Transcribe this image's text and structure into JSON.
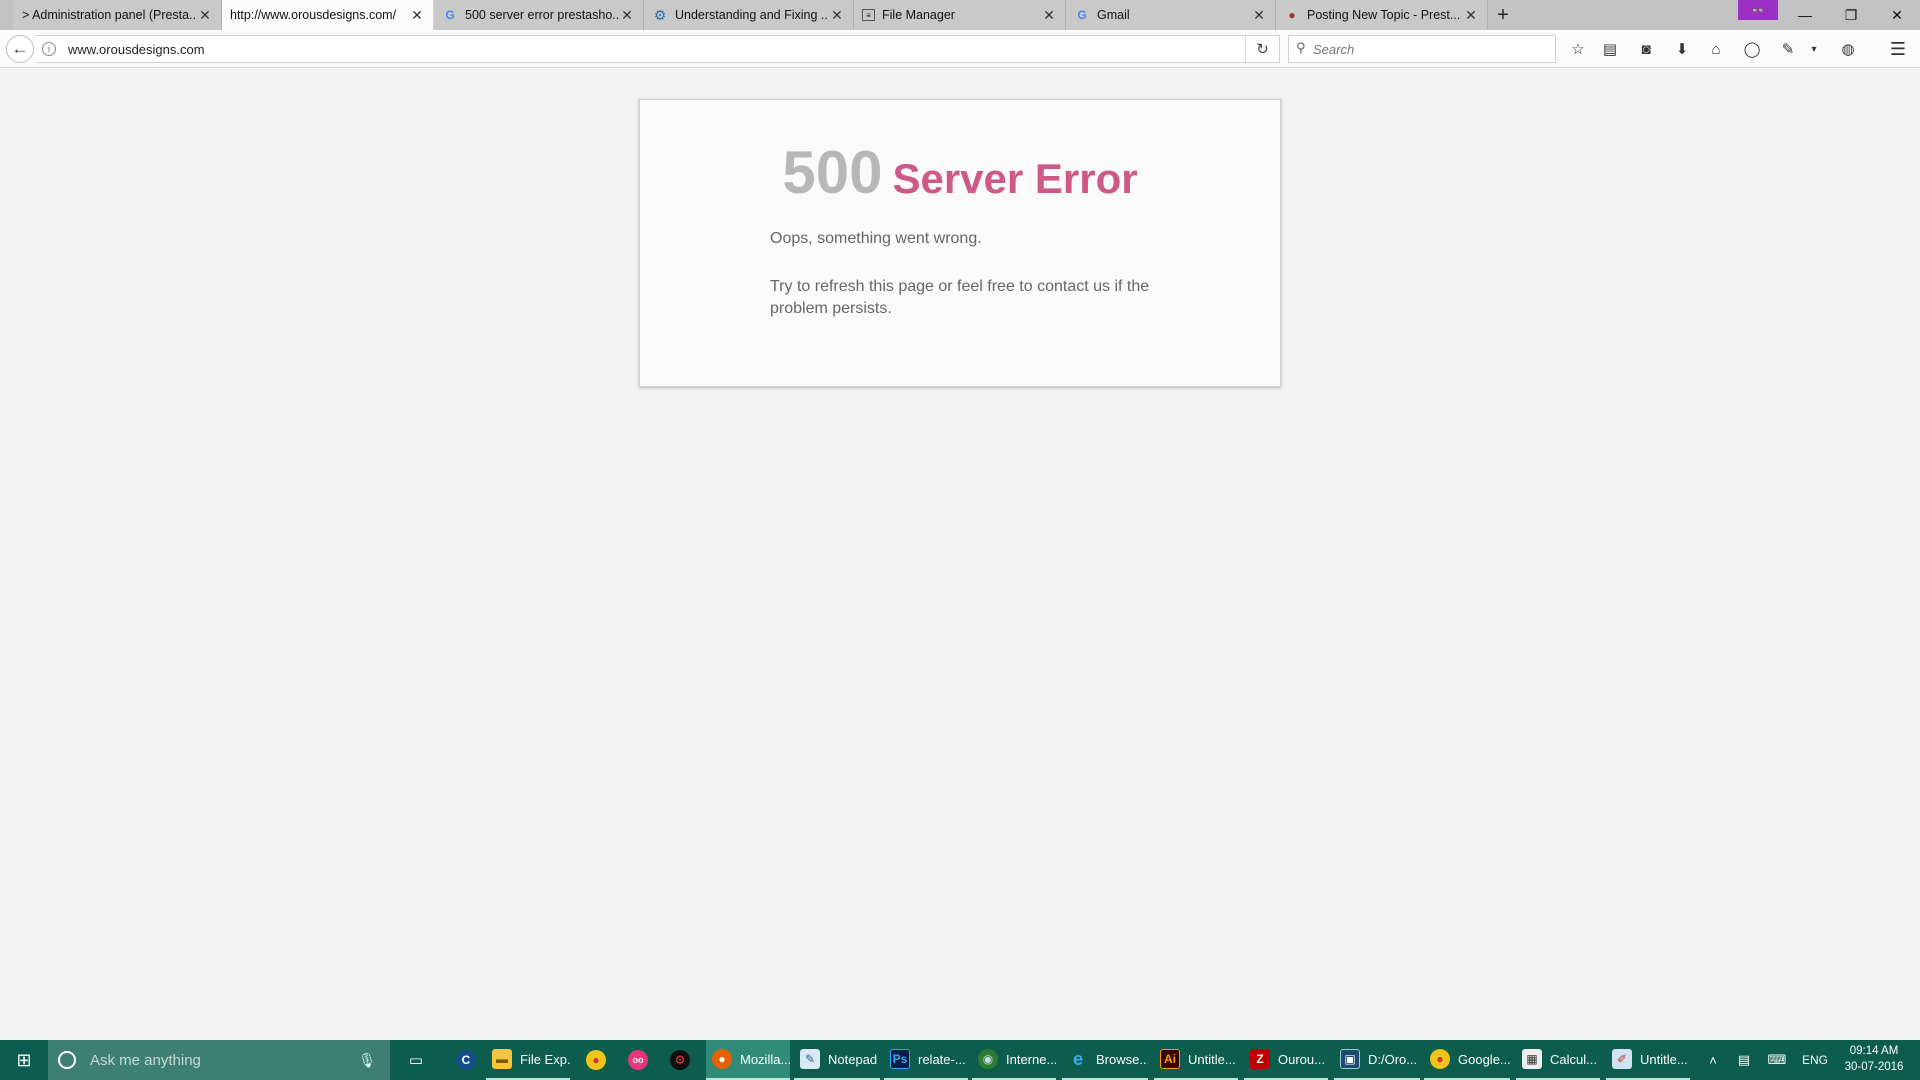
{
  "browser": {
    "tabs": [
      {
        "title": "> Administration panel (Presta...",
        "icon": "page-icon",
        "active": false
      },
      {
        "title": "http://www.orousdesigns.com/",
        "icon": "",
        "active": true
      },
      {
        "title": "500 server error prestasho...",
        "icon": "google-icon",
        "active": false
      },
      {
        "title": "Understanding and Fixing ...",
        "icon": "gear-icon",
        "active": false
      },
      {
        "title": "File Manager",
        "icon": "file-manager-icon",
        "active": false
      },
      {
        "title": "Gmail",
        "icon": "google-icon",
        "active": false
      },
      {
        "title": "Posting New Topic - Prest...",
        "icon": "prestashop-icon",
        "active": false
      }
    ],
    "new_tab_symbol": "+",
    "privacy_badge": "👓",
    "window_controls": {
      "minimize": "—",
      "restore": "❐",
      "close": "✕"
    }
  },
  "navbar": {
    "url": "www.orousdesigns.com",
    "search_placeholder": "Search"
  },
  "page": {
    "error_code": "500",
    "error_title": "Server Error",
    "message_1": "Oops, something went wrong.",
    "message_2": "Try to refresh this page or feel free to contact us if the problem persists."
  },
  "taskbar": {
    "search_placeholder": "Ask me anything",
    "items": [
      {
        "label": "File Exp...",
        "icon": "folder-icon"
      },
      {
        "label": "Mozilla...",
        "icon": "firefox-icon"
      },
      {
        "label": "Notepad",
        "icon": "notepad-icon"
      },
      {
        "label": "relate-...",
        "icon": "photoshop-icon"
      },
      {
        "label": "Interne...",
        "icon": "internet-download-icon"
      },
      {
        "label": "Browse...",
        "icon": "internet-explorer-icon"
      },
      {
        "label": "Untitle...",
        "icon": "illustrator-icon"
      },
      {
        "label": "Ourou...",
        "icon": "filezilla-icon"
      },
      {
        "label": "D:/Oro...",
        "icon": "dreamweaver-icon"
      },
      {
        "label": "Google...",
        "icon": "chrome-icon"
      },
      {
        "label": "Calcul...",
        "icon": "calculator-icon"
      },
      {
        "label": "Untitle...",
        "icon": "paint-icon"
      }
    ],
    "language": "ENG",
    "time": "09:14 AM",
    "date": "30-07-2016"
  },
  "colors": {
    "error_code": "#b7b7b7",
    "error_title": "#cd5987",
    "taskbar": "#0c5d4d",
    "private_badge": "#9b2fc3"
  }
}
